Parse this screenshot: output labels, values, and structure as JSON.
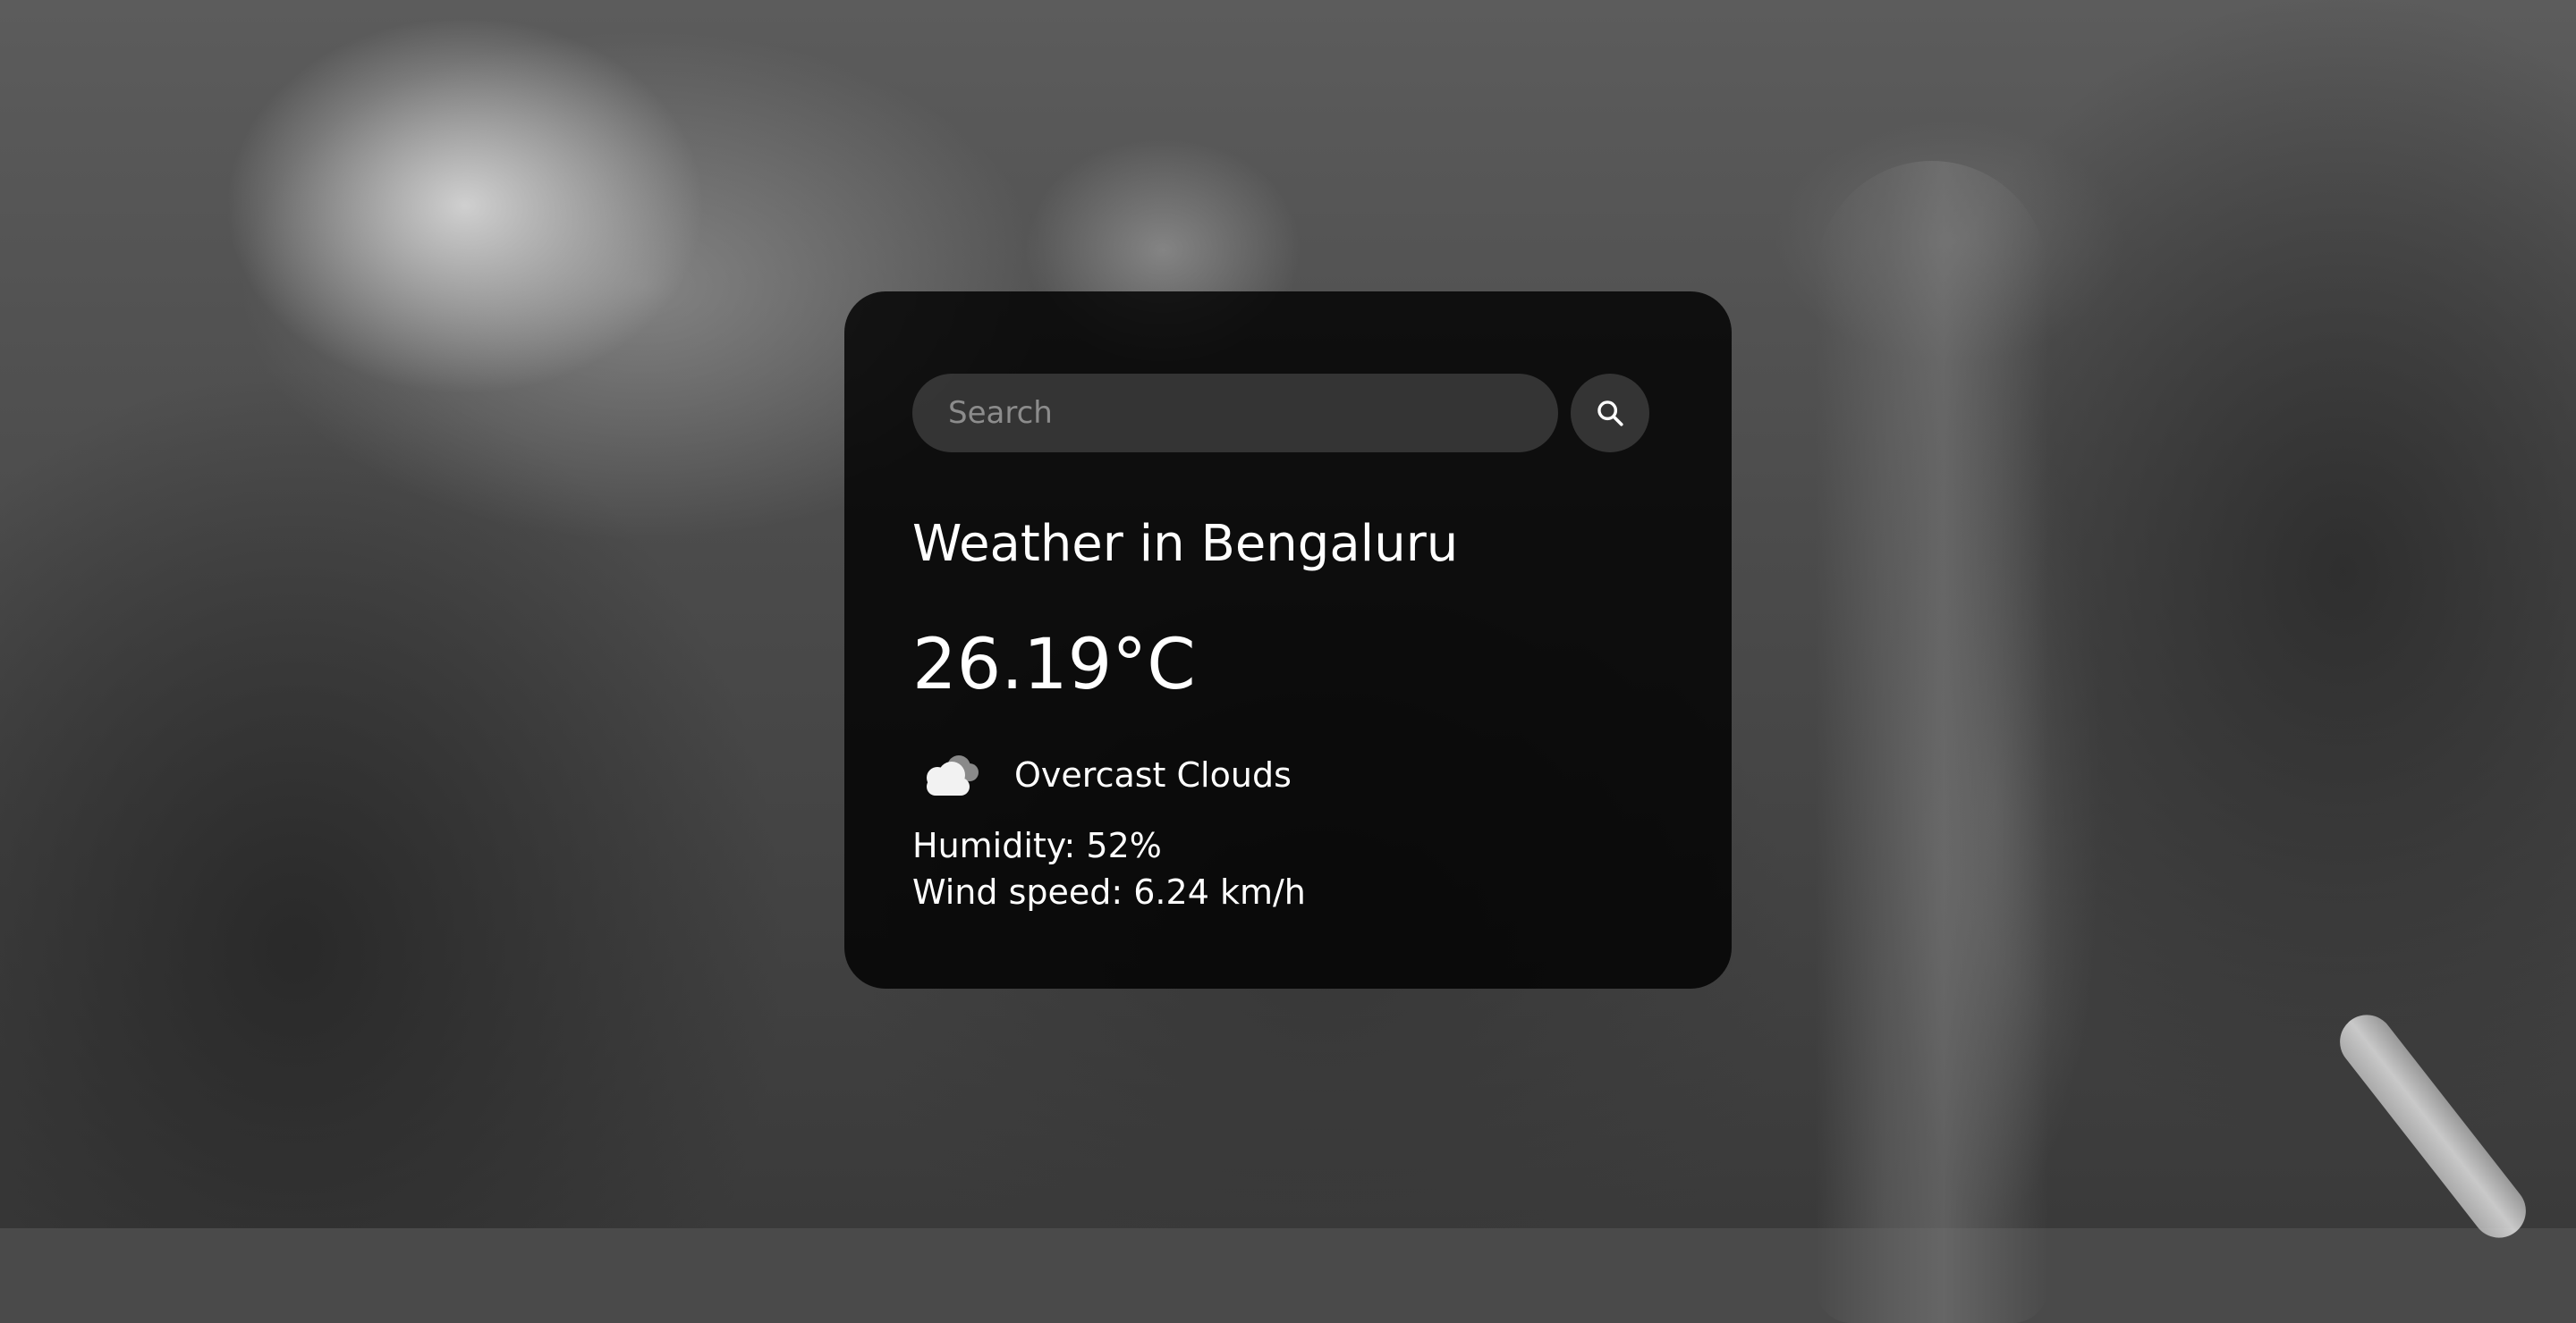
{
  "search": {
    "placeholder": "Search",
    "button_icon": "search-icon"
  },
  "weather": {
    "title": "Weather in Bengaluru",
    "temperature": "26.19°C",
    "condition_icon": "overcast-clouds-icon",
    "description": "Overcast Clouds",
    "humidity": "Humidity: 52%",
    "wind": "Wind speed: 6.24 km/h"
  }
}
